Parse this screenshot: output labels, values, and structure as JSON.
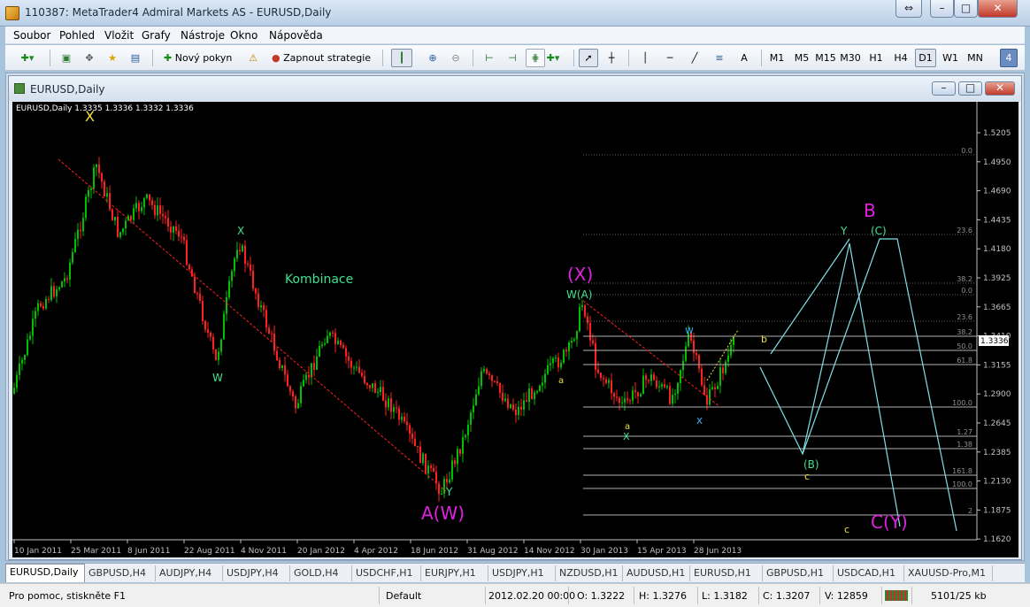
{
  "window": {
    "title": "110387: MetaTrader4 Admiral Markets AS - EURUSD,Daily"
  },
  "menu": [
    "Soubor",
    "Pohled",
    "Vložit",
    "Grafy",
    "Nástroje",
    "Okno",
    "Nápověda"
  ],
  "toolbar": {
    "new_order": "Nový pokyn",
    "autotrading": "Zapnout strategie",
    "timeframes": [
      "M1",
      "M5",
      "M15",
      "M30",
      "H1",
      "H4",
      "D1",
      "W1",
      "MN"
    ],
    "active_timeframe": "D1",
    "badge": "4",
    "text_tool": "A"
  },
  "chart_window": {
    "title": "EURUSD,Daily"
  },
  "chart": {
    "header": "EURUSD,Daily  1.3335 1.3336 1.3332 1.3336",
    "current_price": "1.3336",
    "price_ticks": [
      "1.5205",
      "1.4950",
      "1.4690",
      "1.4435",
      "1.4180",
      "1.3925",
      "1.3665",
      "1.3410",
      "1.3155",
      "1.2900",
      "1.2645",
      "1.2385",
      "1.2130",
      "1.1875",
      "1.1620"
    ],
    "date_ticks": [
      "10 Jan 2011",
      "25 Mar 2011",
      "8 Jun 2011",
      "22 Aug 2011",
      "4 Nov 2011",
      "20 Jan 2012",
      "4 Apr 2012",
      "18 Jun 2012",
      "31 Aug 2012",
      "14 Nov 2012",
      "30 Jan 2013",
      "15 Apr 2013",
      "28 Jun 2013"
    ],
    "fibo_levels": [
      "0.0",
      "23.6",
      "38.2",
      "0.0",
      "23.6",
      "38.2",
      "50.0",
      "61.8",
      "100.0",
      "1.27",
      "1.38",
      "161.8",
      "100.0",
      "2"
    ],
    "labels": {
      "top_x": "X",
      "w1": "W",
      "x1": "X",
      "kombinace": "Kombinace",
      "y1": "Y",
      "aw": "A(W)",
      "big_x": "(X)",
      "wa": "W(A)",
      "a_small": "a",
      "a_yellow": "a",
      "x_green": "X",
      "w_blue": "w",
      "x_blue": "x",
      "b_small": "b",
      "big_b": "B",
      "y_green": "Y",
      "c_paren": "(C)",
      "b_paren": "(B)",
      "c_small": "c",
      "c_small2": "c",
      "cy": "C(Y)"
    }
  },
  "tabs": [
    "EURUSD,Daily",
    "GBPUSD,H4",
    "AUDJPY,H4",
    "USDJPY,H4",
    "GOLD,H4",
    "USDCHF,H1",
    "EURJPY,H1",
    "USDJPY,H1",
    "NZDUSD,H1",
    "AUDUSD,H1",
    "EURUSD,H1",
    "GBPUSD,H1",
    "USDCAD,H1",
    "XAUUSD-Pro,M1"
  ],
  "active_tab": "EURUSD,Daily",
  "status": {
    "help": "Pro pomoc, stiskněte F1",
    "profile": "Default",
    "datetime": "2012.02.20 00:00",
    "open": "O: 1.3222",
    "high": "H: 1.3276",
    "low": "L: 1.3182",
    "close": "C: 1.3207",
    "volume": "V: 12859",
    "traffic": "5101/25 kb"
  },
  "colors": {
    "bull": "#00c000",
    "bear": "#ff2020",
    "magenta": "#e020e0",
    "green_label": "#40e090",
    "cyan": "#80e0e8",
    "yellow": "#f0e040"
  }
}
